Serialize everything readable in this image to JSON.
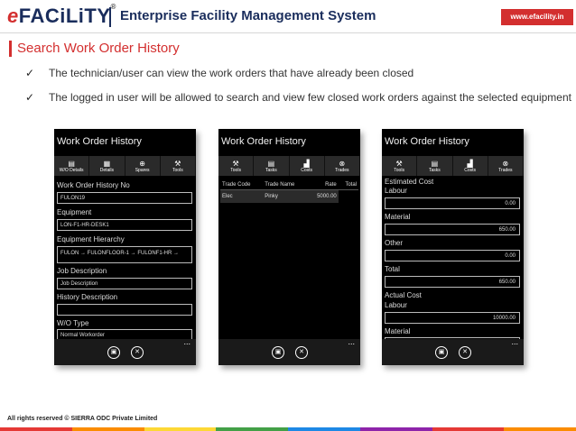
{
  "header": {
    "logo_text": "FACiLiTY",
    "logo_e": "e",
    "logo_reg": "®",
    "title": "Enterprise Facility Management System",
    "url": "www.efacility.in"
  },
  "section_title": "Search Work Order History",
  "bullets": [
    "The technician/user can view the work orders that have already been closed",
    "The logged in user will be allowed to search and view few closed work orders against the selected equipment"
  ],
  "phones": [
    {
      "title": "Work Order History",
      "tabs": [
        "W/O Details",
        "Details",
        "Spares",
        "Tools"
      ],
      "fields": [
        {
          "label": "Work Order History No",
          "value": "FULON19"
        },
        {
          "label": "Equipment",
          "value": "LON-F1-HR-DESK1"
        },
        {
          "label": "Equipment Hierarchy",
          "value": "FULON → FULONFLOOR-1 → FULONF1-HR →"
        },
        {
          "label": "Job Description",
          "value": "Job Description"
        },
        {
          "label": "History Description",
          "value": ""
        },
        {
          "label": "W/O Type",
          "value": "Normal Workorder"
        }
      ]
    },
    {
      "title": "Work Order History",
      "tabs": [
        "Tools",
        "Tasks",
        "Costs",
        "Trades"
      ],
      "columns": [
        "Trade Code",
        "Trade Name",
        "Rate",
        "Total"
      ],
      "rows": [
        [
          "Elec",
          "Pinky",
          "5000.00",
          ""
        ]
      ]
    },
    {
      "title": "Work Order History",
      "tabs": [
        "Tools",
        "Tasks",
        "Costs",
        "Trades"
      ],
      "heading_estimated": "Estimated Cost",
      "heading_actual": "Actual Cost",
      "fields": [
        {
          "label": "Labour",
          "value": "0.00"
        },
        {
          "label": "Material",
          "value": "650.00"
        },
        {
          "label": "Other",
          "value": "0.00"
        },
        {
          "label": "Total",
          "value": "650.00"
        },
        {
          "label": "Labour",
          "value": "10000.00"
        },
        {
          "label": "Material",
          "value": ""
        }
      ]
    }
  ],
  "app_bar": {
    "save_icon": "save-icon",
    "cancel_icon": "cancel-icon",
    "more": "..."
  },
  "footer": {
    "text": "All rights reserved © SIERRA ODC Private Limited",
    "colors": [
      "#e53935",
      "#fb8c00",
      "#fdd835",
      "#43a047",
      "#1e88e5",
      "#8e24aa",
      "#e53935",
      "#fb8c00"
    ]
  }
}
